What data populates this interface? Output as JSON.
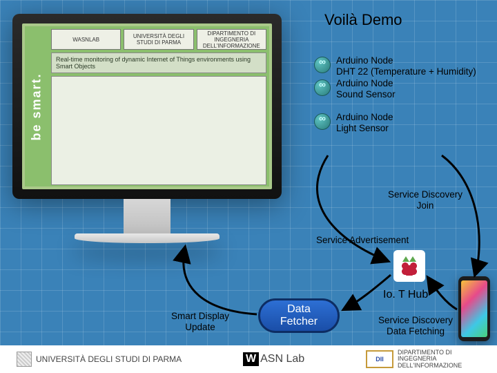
{
  "title": "Voilà Demo",
  "monitor": {
    "sidebar_text": "be smart.",
    "logos": [
      "WASNLAB",
      "UNIVERSITÀ DEGLI STUDI DI PARMA",
      "DIPARTIMENTO DI INGEGNERIA DELL'INFORMAZIONE"
    ],
    "caption": "Real-time monitoring of dynamic Internet of Things environments using Smart Objects"
  },
  "nodes": [
    {
      "title": "Arduino Node",
      "subtitle": "DHT 22 (Temperature + Humidity)"
    },
    {
      "title": "Arduino Node",
      "subtitle": "Sound Sensor"
    },
    {
      "title": "Arduino Node",
      "subtitle": "Light Sensor"
    }
  ],
  "labels": {
    "service_discovery_join": "Service Discovery\nJoin",
    "service_advertisement": "Service Advertisement",
    "iot_hub": "Io. T Hub",
    "smart_display_update": "Smart Display\nUpdate",
    "data_fetcher": "Data\nFetcher",
    "service_discovery_data_fetching": "Service Discovery\nData Fetching"
  },
  "footer": {
    "left": "UNIVERSITÀ DEGLI STUDI DI PARMA",
    "mid_prefix": "W",
    "mid_rest": "ASN Lab",
    "right": "DIPARTIMENTO DI INGEGNERIA DELL'INFORMAZIONE"
  },
  "colors": {
    "bg": "#3a82b8",
    "screen_green": "#8bbf6d",
    "pill_blue": "#1a4ea8"
  }
}
